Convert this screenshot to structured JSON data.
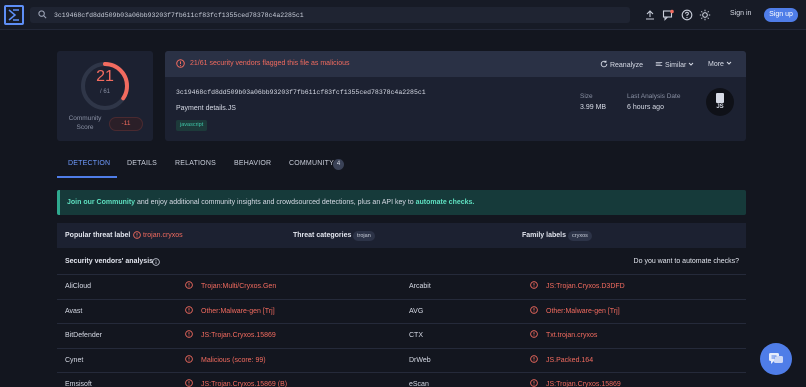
{
  "colors": {
    "accent": "#4f7de8",
    "danger": "#f26b5f",
    "teal": "#2fa98f",
    "background": "#13161f",
    "card": "#1c2131"
  },
  "header": {
    "logo_icon": "virustotal-logo-icon",
    "search_value": "3c19468cfd8dd509b03a06bb93203f7fb611cf83fcf1355ced78378c4a2285c1",
    "icons": [
      "upload-icon",
      "notifications-icon",
      "help-icon",
      "theme-icon"
    ],
    "sign_in": "Sign in",
    "sign_up": "Sign up"
  },
  "score": {
    "detections": "21",
    "total": "/ 61",
    "detection_fraction": 0.344,
    "community_label": "Community Score",
    "community_value": "-11"
  },
  "summary": {
    "alert": "21/61 security vendors flagged this file as malicious",
    "actions": {
      "reanalyze": "Reanalyze",
      "similar": "Similar",
      "more": "More"
    },
    "hash": "3c19468cfd8dd509b03a06bb93203f7fb611cf83fcf1355ced78378c4a2285c1",
    "filename": "Payment details.JS",
    "tag": "javascript",
    "size_label": "Size",
    "size_value": "3.99 MB",
    "date_label": "Last Analysis Date",
    "date_value": "6 hours ago",
    "file_type": "JS"
  },
  "tabs": [
    {
      "label": "DETECTION",
      "active": true
    },
    {
      "label": "DETAILS"
    },
    {
      "label": "RELATIONS"
    },
    {
      "label": "BEHAVIOR"
    },
    {
      "label": "COMMUNITY",
      "count": "4"
    }
  ],
  "banner": {
    "community_link": "Join our Community",
    "middle": " and enjoy additional community insights and crowdsourced detections, plus an API key to ",
    "automate_link": "automate checks."
  },
  "threat": {
    "popular_label": "Popular threat label",
    "popular_value": "trojan.cryxos",
    "categories_label": "Threat categories",
    "categories_value": "trojan",
    "family_label": "Family labels",
    "family_value": "cryxos"
  },
  "vendors": {
    "title": "Security vendors' analysis",
    "automate_question": "Do you want to automate checks?",
    "rows": [
      {
        "left_name": "AliCloud",
        "left_result": "Trojan:Multi/Cryxos.Gen",
        "right_name": "Arcabit",
        "right_result": "JS:Trojan.Cryxos.D3DFD"
      },
      {
        "left_name": "Avast",
        "left_result": "Other:Malware-gen [Trj]",
        "right_name": "AVG",
        "right_result": "Other:Malware-gen [Trj]"
      },
      {
        "left_name": "BitDefender",
        "left_result": "JS:Trojan.Cryxos.15869",
        "right_name": "CTX",
        "right_result": "Txt.trojan.cryxos"
      },
      {
        "left_name": "Cynet",
        "left_result": "Malicious (score: 99)",
        "right_name": "DrWeb",
        "right_result": "JS.Packed.164"
      },
      {
        "left_name": "Emsisoft",
        "left_result": "JS:Trojan.Cryxos.15869 (B)",
        "right_name": "eScan",
        "right_result": "JS:Trojan.Cryxos.15869"
      }
    ]
  }
}
